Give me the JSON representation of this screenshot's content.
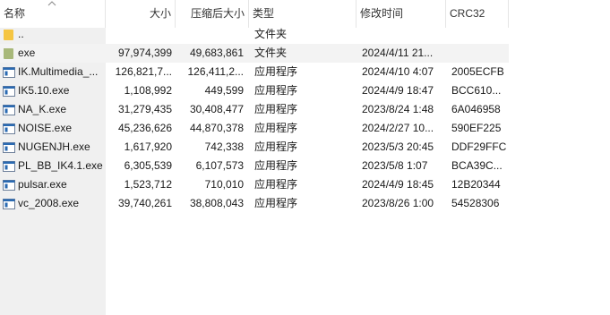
{
  "columns": {
    "name": "名称",
    "size": "大小",
    "packed": "压缩后大小",
    "type": "类型",
    "modified": "修改时间",
    "crc": "CRC32"
  },
  "colors": {
    "folder": "#f5c542",
    "folder_selected": "#a8b87a",
    "exe_icon": "#2a6ab2"
  },
  "rows": [
    {
      "icon": "folder-icon",
      "name": "..",
      "size": "",
      "packed": "",
      "type": "文件夹",
      "modified": "",
      "crc": ""
    },
    {
      "icon": "folder-icon",
      "name": "exe",
      "size": "97,974,399",
      "packed": "49,683,861",
      "type": "文件夹",
      "modified": "2024/4/11 21...",
      "crc": "",
      "selected": true
    },
    {
      "icon": "exe-icon",
      "name": "IK.Multimedia_...",
      "size": "126,821,7...",
      "packed": "126,411,2...",
      "type": "应用程序",
      "modified": "2024/4/10 4:07",
      "crc": "2005ECFB"
    },
    {
      "icon": "exe-icon",
      "name": "IK5.10.exe",
      "size": "1,108,992",
      "packed": "449,599",
      "type": "应用程序",
      "modified": "2024/4/9 18:47",
      "crc": "BCC610..."
    },
    {
      "icon": "exe-icon",
      "name": "NA_K.exe",
      "size": "31,279,435",
      "packed": "30,408,477",
      "type": "应用程序",
      "modified": "2023/8/24 1:48",
      "crc": "6A046958"
    },
    {
      "icon": "exe-icon",
      "name": "NOISE.exe",
      "size": "45,236,626",
      "packed": "44,870,378",
      "type": "应用程序",
      "modified": "2024/2/27 10...",
      "crc": "590EF225"
    },
    {
      "icon": "exe-icon",
      "name": "NUGENJH.exe",
      "size": "1,617,920",
      "packed": "742,338",
      "type": "应用程序",
      "modified": "2023/5/3 20:45",
      "crc": "DDF29FFC"
    },
    {
      "icon": "exe-icon",
      "name": "PL_BB_IK4.1.exe",
      "size": "6,305,539",
      "packed": "6,107,573",
      "type": "应用程序",
      "modified": "2023/5/8 1:07",
      "crc": "BCA39C..."
    },
    {
      "icon": "exe-icon",
      "name": "pulsar.exe",
      "size": "1,523,712",
      "packed": "710,010",
      "type": "应用程序",
      "modified": "2024/4/9 18:45",
      "crc": "12B20344"
    },
    {
      "icon": "exe-icon",
      "name": "vc_2008.exe",
      "size": "39,740,261",
      "packed": "38,808,043",
      "type": "应用程序",
      "modified": "2023/8/26 1:00",
      "crc": "54528306"
    }
  ]
}
